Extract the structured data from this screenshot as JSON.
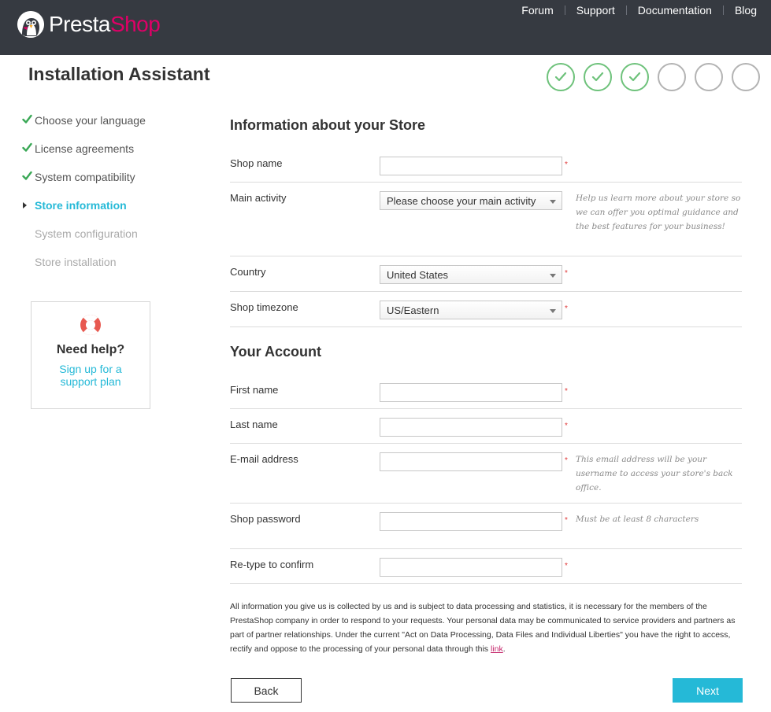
{
  "header": {
    "brand_part1": "Presta",
    "brand_part2": "Shop",
    "nav": [
      "Forum",
      "Support",
      "Documentation",
      "Blog"
    ]
  },
  "page_title": "Installation Assistant",
  "progress": {
    "completed_steps": 3,
    "total_steps": 6
  },
  "sidebar": {
    "steps": [
      {
        "label": "Choose your language",
        "state": "done"
      },
      {
        "label": "License agreements",
        "state": "done"
      },
      {
        "label": "System compatibility",
        "state": "done"
      },
      {
        "label": "Store information",
        "state": "active"
      },
      {
        "label": "System configuration",
        "state": "todo"
      },
      {
        "label": "Store installation",
        "state": "todo"
      }
    ],
    "help": {
      "title": "Need help?",
      "link": "Sign up for a support plan",
      "icon": "lifebuoy-icon"
    }
  },
  "store_section": {
    "title": "Information about your Store",
    "shop_name": {
      "label": "Shop name",
      "value": ""
    },
    "main_activity": {
      "label": "Main activity",
      "value": "Please choose your main activity",
      "hint": "Help us learn more about your store so we can offer you optimal guidance and the best features for your business!"
    },
    "country": {
      "label": "Country",
      "value": "United States"
    },
    "timezone": {
      "label": "Shop timezone",
      "value": "US/Eastern"
    }
  },
  "account_section": {
    "title": "Your Account",
    "first_name": {
      "label": "First name",
      "value": ""
    },
    "last_name": {
      "label": "Last name",
      "value": ""
    },
    "email": {
      "label": "E-mail address",
      "value": "",
      "hint": "This email address will be your username to access your store's back office."
    },
    "password": {
      "label": "Shop password",
      "value": "",
      "hint": "Must be at least 8 characters"
    },
    "confirm": {
      "label": "Re-type to confirm",
      "value": ""
    }
  },
  "required_marker": "*",
  "privacy": {
    "text": "All information you give us is collected by us and is subject to data processing and statistics, it is necessary for the members of the PrestaShop company in order to respond to your requests. Your personal data may be communicated to service providers and partners as part of partner relationships. Under the current \"Act on Data Processing, Data Files and Individual Liberties\" you have the right to access, rectify and oppose to the processing of your personal data through this",
    "link": "link",
    "end": "."
  },
  "buttons": {
    "back": "Back",
    "next": "Next"
  },
  "colors": {
    "header_bg": "#363a41",
    "brand_pink": "#df0067",
    "accent": "#25b9d7",
    "done_green": "#6ec27b",
    "required_red": "#e03a3a"
  }
}
